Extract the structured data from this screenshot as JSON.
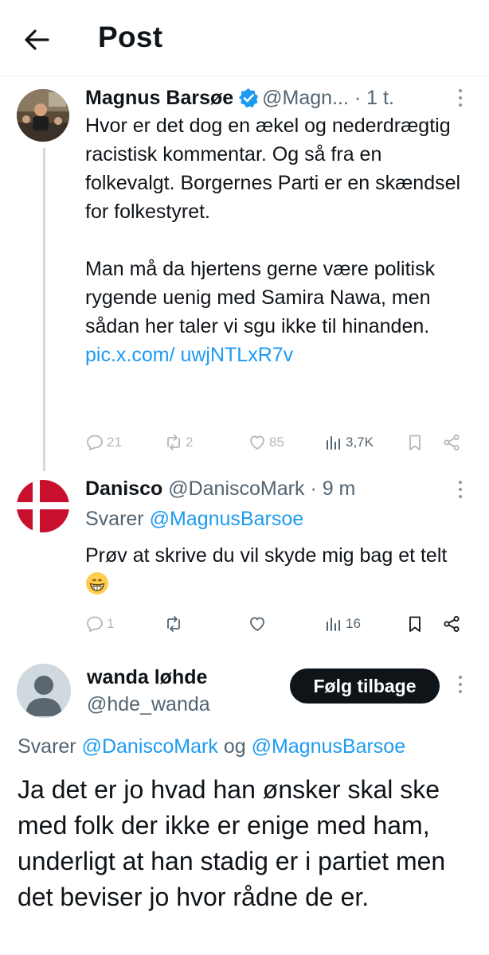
{
  "header": {
    "title": "Post"
  },
  "tweet1": {
    "name": "Magnus Barsøe",
    "handle": "@Magn...",
    "time": "· 1 t.",
    "paragraph1": "Hvor er det dog en ækel og nederdrægtig racistisk kommentar. Og så fra en folkevalgt. Borgernes Parti er en skændsel for folkestyret.",
    "paragraph2": "Man må da hjertens gerne være politisk rygende uenig med Samira Nawa, men sådan her taler vi sgu ikke til hinanden.",
    "link": "pic.x.com/ uwjNTLxR7v",
    "replies": "21",
    "reposts": "2",
    "likes": "85",
    "views": "3,7K"
  },
  "tweet2": {
    "name": "Danisco",
    "handle": "@DaniscoMark",
    "time": "· 9 m",
    "reply_prefix": "Svarer",
    "reply_to": "@MagnusBarsoe",
    "text": "Prøv at skrive du vil skyde mig bag et telt",
    "emoji": "grinning-face",
    "replies": "1",
    "views": "16"
  },
  "tweet3": {
    "name": "wanda løhde",
    "handle": "@hde_wanda",
    "follow_label": "Følg tilbage",
    "reply_prefix": "Svarer",
    "reply_to_1": "@DaniscoMark",
    "reply_and": "og",
    "reply_to_2": "@MagnusBarsoe",
    "text": "Ja det er jo hvad han ønsker skal ske med folk der ikke er enige med ham, underligt at han stadig er i partiet men det beviser jo hvor rådne de er."
  },
  "colors": {
    "accent": "#1d9bf0",
    "text": "#0f1419",
    "secondary": "#536471",
    "flag_red": "#c8102e"
  }
}
